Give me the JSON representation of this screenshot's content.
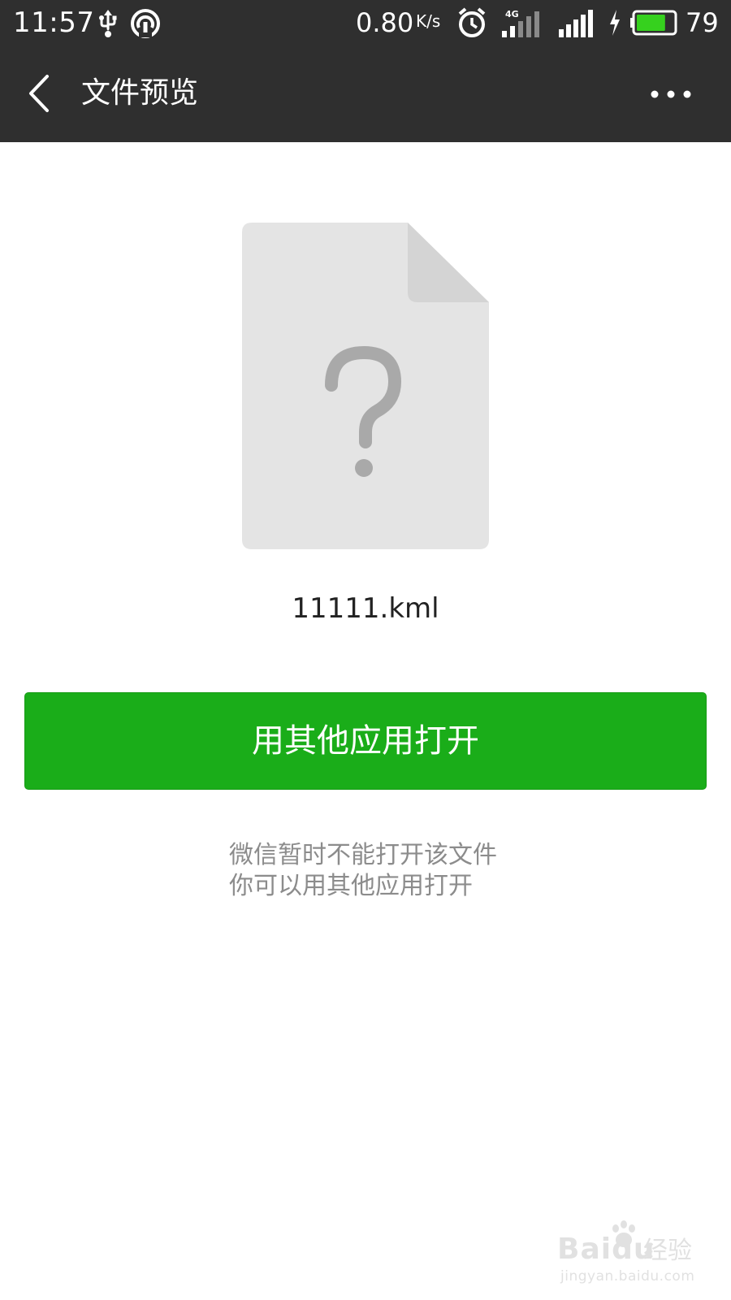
{
  "status_bar": {
    "time": "11:57",
    "net_speed": "0.80",
    "net_speed_unit": "K/s",
    "network_type": "4G",
    "battery_level": "79",
    "battery_fraction": 0.79,
    "icons": [
      "usb-icon",
      "hotspot-icon",
      "alarm-icon",
      "signal-4g-icon",
      "signal-icon",
      "charging-icon",
      "battery-icon"
    ]
  },
  "nav": {
    "back_icon": "chevron-left-icon",
    "title": "文件预览",
    "more_icon": "more-dots-icon"
  },
  "file": {
    "icon": "unknown-file-icon",
    "name": "11111.kml"
  },
  "open_button": {
    "label": "用其他应用打开"
  },
  "hint": {
    "line1": "微信暂时不能打开该文件",
    "line2": "你可以用其他应用打开"
  },
  "watermark": {
    "brand": "Baidu",
    "brand_cn": "经验",
    "url": "jingyan.baidu.com"
  },
  "colors": {
    "topbar": "#2f2f2f",
    "button": "#1aad19",
    "battery_fill": "#36d11e",
    "file_icon": "#e4e4e4",
    "hint_text": "#8c8c8c"
  }
}
